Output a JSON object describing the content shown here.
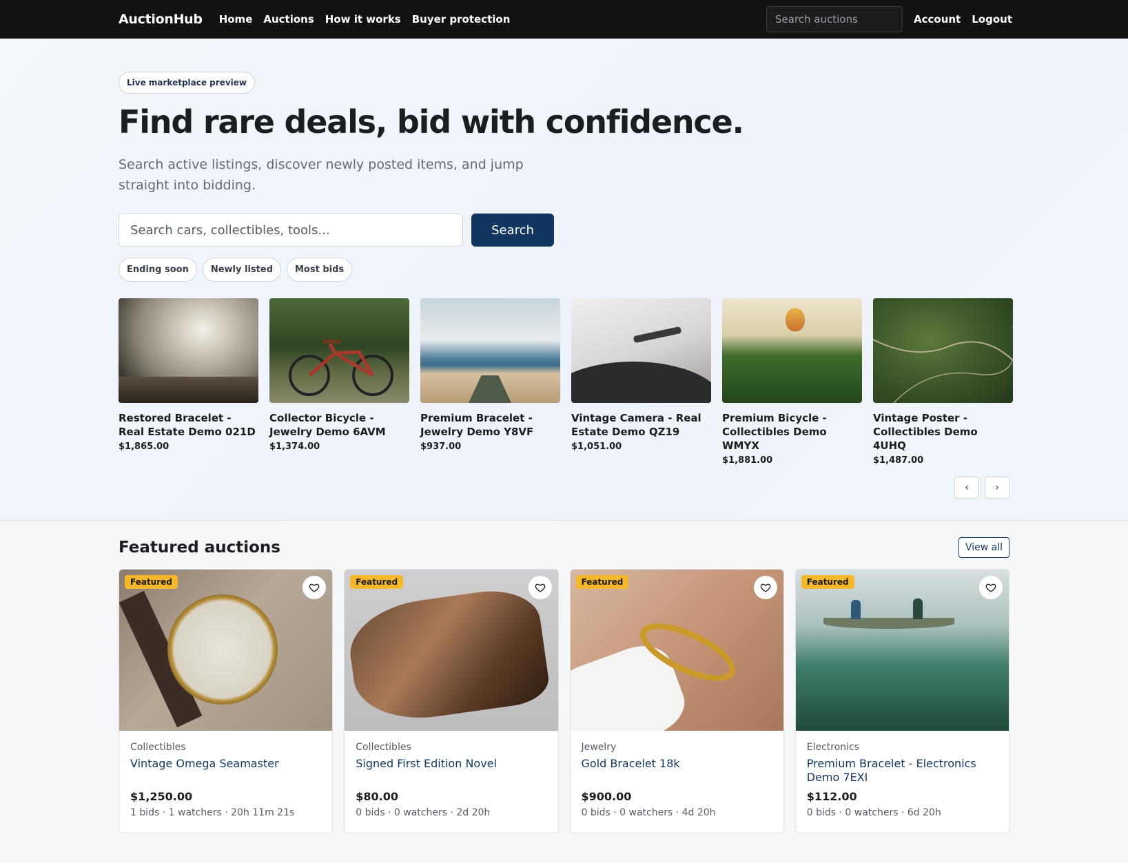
{
  "nav": {
    "brand": "AuctionHub",
    "links": [
      "Home",
      "Auctions",
      "How it works",
      "Buyer protection"
    ],
    "search_placeholder": "Search auctions",
    "account": "Account",
    "logout": "Logout"
  },
  "hero": {
    "pill": "Live marketplace preview",
    "title": "Find rare deals, bid with confidence.",
    "subtitle": "Search active listings, discover newly posted items, and jump straight into bidding.",
    "search_placeholder": "Search cars, collectibles, tools...",
    "search_button": "Search",
    "chips": [
      "Ending soon",
      "Newly listed",
      "Most bids"
    ]
  },
  "carousel": [
    {
      "title": "Restored Bracelet - Real Estate Demo 021D",
      "price": "$1,865.00",
      "image": "sky-clouds-landscape"
    },
    {
      "title": "Collector Bicycle - Jewelry Demo 6AVM",
      "price": "$1,374.00",
      "image": "vintage-bicycle"
    },
    {
      "title": "Premium Bracelet - Jewelry Demo Y8VF",
      "price": "$937.00",
      "image": "beach-boardwalk"
    },
    {
      "title": "Vintage Camera - Real Estate Demo QZ19",
      "price": "$1,051.00",
      "image": "record-player"
    },
    {
      "title": "Premium Bicycle - Collectibles Demo WMYX",
      "price": "$1,881.00",
      "image": "hot-air-balloon-palms"
    },
    {
      "title": "Vintage Poster - Collectibles Demo 4UHQ",
      "price": "$1,487.00",
      "image": "aerial-green-hills"
    }
  ],
  "featured": {
    "title": "Featured auctions",
    "view_all": "View all",
    "badge": "Featured",
    "items": [
      {
        "category": "Collectibles",
        "title": "Vintage Omega Seamaster",
        "price": "$1,250.00",
        "meta": "1 bids · 1 watchers · 20h 11m 21s",
        "image": "gold-wristwatch"
      },
      {
        "category": "Collectibles",
        "title": "Signed First Edition Novel",
        "price": "$80.00",
        "meta": "0 bids · 0 watchers · 2d 20h",
        "image": "old-book"
      },
      {
        "category": "Jewelry",
        "title": "Gold Bracelet 18k",
        "price": "$900.00",
        "meta": "0 bids · 0 watchers · 4d 20h",
        "image": "gold-bracelet"
      },
      {
        "category": "Electronics",
        "title": "Premium Bracelet - Electronics Demo 7EXI",
        "price": "$112.00",
        "meta": "0 bids · 0 watchers · 6d 20h",
        "image": "canoe-on-lake"
      }
    ]
  }
}
